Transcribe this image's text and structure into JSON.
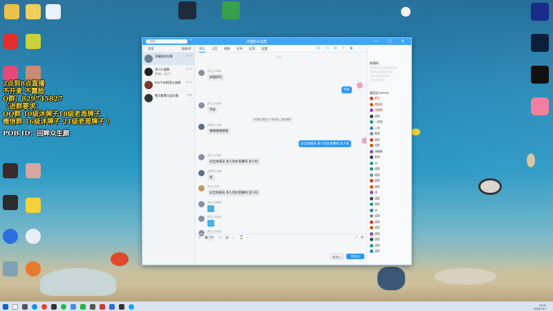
{
  "overlay": {
    "line1": "2点到8点直播",
    "line2": "不开麦 不露脸",
    "line3": "Q群：829745827",
    "line4": "（进群要求：",
    "line5": "QQ群 10级沐牌子18级老周牌子",
    "line6": "微信群 16级沐牌子 21级老周牌子 ）",
    "line7": "POB ID：回眸众生颜"
  },
  "window": {
    "title": "沐猫粉水友群",
    "search_placeholder": "搜索",
    "left_tabs": [
      "消息",
      "群助手"
    ],
    "conversations": [
      {
        "name": "沐猫粉水友群",
        "preview": "",
        "time": "09:19",
        "color": "#6a7f95"
      },
      {
        "name": "沐儿小迷群",
        "preview": "[群聊]：[图片]",
        "time": "09:12",
        "color": "#222"
      },
      {
        "name": "Pos卡IN同型公会群",
        "preview": "",
        "time": "08:23",
        "color": "#7a3a2a"
      },
      {
        "name": "我马群我马设计群",
        "preview": "",
        "time": "昨天",
        "color": "#333"
      }
    ],
    "chat_tabs": [
      "聊天",
      "公告",
      "相册",
      "文件",
      "应用",
      "设置"
    ],
    "messages": [
      {
        "who": "[群主] 沐猫粉",
        "text": "沐猫好吗",
        "dir": "in"
      },
      {
        "who": "",
        "text": "不好",
        "dir": "out"
      },
      {
        "who": "[群主] 沐猫粉",
        "text": "不好",
        "dir": "in"
      },
      {
        "who": "[管理员] 沐猫",
        "text": "嘿嘿嘿嘿嘿嘿",
        "dir": "in"
      },
      {
        "who": "",
        "text": "@全体成员 有人玩水友赛吗 没人吗",
        "dir": "out"
      },
      {
        "who": "[群主] 沐猫粉",
        "text": "@全体成员 有人玩水友赛吗 没人吗",
        "dir": "in"
      },
      {
        "who": "[管理员] 沐猫",
        "text": "有",
        "dir": "in"
      },
      {
        "who": "[群主] 沐猫",
        "text": "@全体成员 有人玩水友赛吗 没人吗",
        "dir": "in"
      },
      {
        "who": "[群主] 沐猫粉",
        "text": "",
        "dir": "in"
      },
      {
        "who": "[群主] 沐猫粉",
        "text": "",
        "dir": "in"
      },
      {
        "who": "[群主] 沐猫粉",
        "text": "?",
        "dir": "in"
      }
    ],
    "system_msg": "沐猫粉 撤回了一条消息，重新编辑",
    "time_hint": "09:10",
    "buttons": {
      "close": "关闭(C)",
      "send": "发送(S)"
    },
    "notice_header": "群通知",
    "member_header": "群成员 57/174",
    "members": [
      "群主",
      "管理员",
      "沐猫粉",
      "成员",
      "—成员",
      "三月",
      "鱼类",
      "成员",
      "成员",
      "沐猫粉",
      "阿沐",
      "Mr",
      "成员",
      "成员",
      "成员",
      "成员",
      "沐",
      "成员",
      "成员",
      "Mr",
      "成员",
      "成员",
      "成员",
      "成员",
      "成员",
      "成员",
      "成员"
    ]
  },
  "taskbar": {
    "time": "14:41",
    "date": "2023/7/17"
  },
  "desktop": {
    "icons": [
      "QQ音乐",
      "WPS",
      "Ps",
      "CapCut",
      "bilibili"
    ]
  }
}
